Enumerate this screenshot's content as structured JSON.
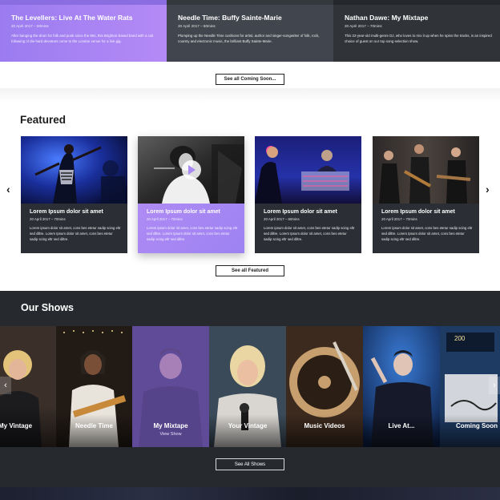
{
  "coming_soon": {
    "cards": [
      {
        "title": "The Levellers: Live At The Water Rats",
        "meta": "20 April 2017 – 60mins",
        "desc": "After banging the drum for folk and punk since the 90s, this Brighton-based band with a cult following of die-hard devotees come to the London venue for a live gig."
      },
      {
        "title": "Needle Time: Buffy Sainte-Marie",
        "meta": "20 April 2017 – 60mins",
        "desc": "Plumping up the Needle Time cushions for artist, author and singer-songwriter of folk, rock, country and electronic music, the brilliant Buffy Sainte-Marie."
      },
      {
        "title": "Nathan Dawe: My Mixtape",
        "meta": "20 April 2017 – 70mins",
        "desc": "This 22-year-old multi-genre DJ, who loves to mix it up when he spins the tracks, is an inspired choice of guest on our top song selection show."
      }
    ],
    "see_all_label": "See all Coming Soon..."
  },
  "featured": {
    "heading": "Featured",
    "cards": [
      {
        "title": "Lorem Ipsum dolor sit amet",
        "meta": "20 April 2017 – 70mins",
        "desc": "Lorem ipsum dolor sit amet, cons bes etetur sadip scing eltr sed diltre. Lorem Ipsum dolor sit amet, cons bes etetur sadip scing eltr sed diltre."
      },
      {
        "title": "Lorem Ipsum dolor sit amet",
        "meta": "20 April 2017 – 70mins",
        "desc": "Lorem ipsum dolor sit amet, cons bes etetur sadip scing eltr sed diltre. Lorem Ipsum dolor sit amet, cons bes etetur sadip scing eltr sed diltre."
      },
      {
        "title": "Lorem Ipsum dolor sit amet",
        "meta": "20 April 2017 – 60mins",
        "desc": "Lorem ipsum dolor sit amet, cons bes etetur sadip scing eltr sed diltre. Lorem Ipsum dolor sit amet, cons bes etetur sadip scing eltr sed diltre."
      },
      {
        "title": "Lorem Ipsum dolor sit amet",
        "meta": "20 April 2017 – 70mins",
        "desc": "Lorem ipsum dolor sit amet, cons bes etetur sadip scing eltr sed diltre. Lorem Ipsum dolor sit amet, cons bes etetur sadip scing eltr sed diltre."
      }
    ],
    "see_all_label": "See all Featured",
    "prev_glyph": "‹",
    "next_glyph": "›"
  },
  "shows": {
    "heading": "Our Shows",
    "tiles": [
      {
        "label": "My Vintage",
        "sub": ""
      },
      {
        "label": "Needle Time",
        "sub": ""
      },
      {
        "label": "My Mixtape",
        "sub": "View Show"
      },
      {
        "label": "Your Vintage",
        "sub": ""
      },
      {
        "label": "Music Videos",
        "sub": ""
      },
      {
        "label": "Live At...",
        "sub": ""
      },
      {
        "label": "Coming Soon",
        "sub": ""
      }
    ],
    "see_all_label": "See All Shows",
    "prev_glyph": "‹",
    "next_glyph": "›"
  },
  "colors": {
    "accent_purple": "#a98af4",
    "dark_card": "#2b2f35",
    "shows_bg": "#26292e"
  }
}
